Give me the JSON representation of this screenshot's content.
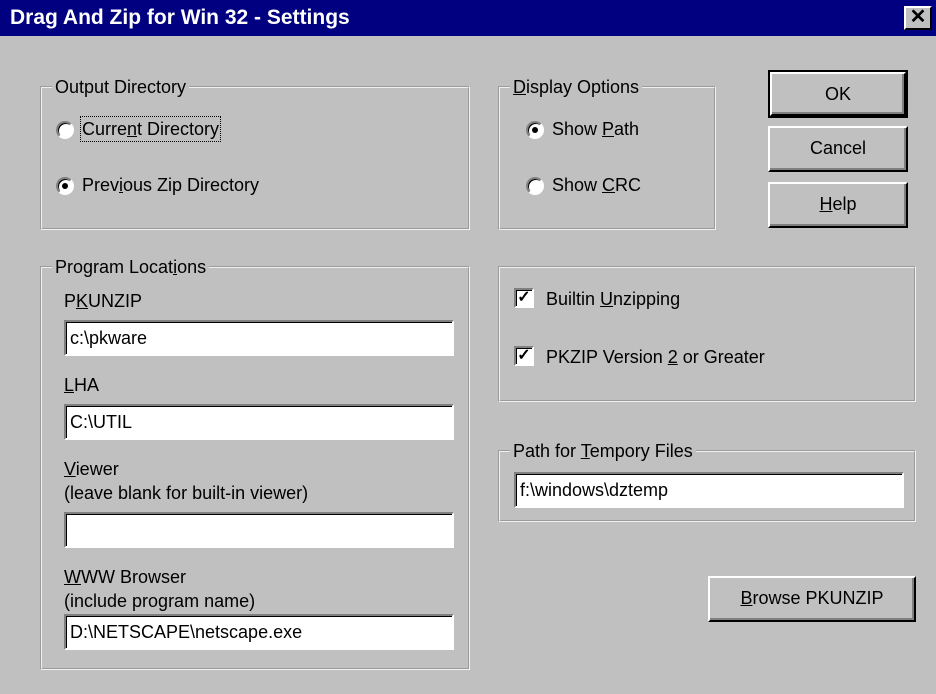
{
  "window": {
    "title": "Drag And Zip for Win 32 - Settings",
    "close_glyph": "✕"
  },
  "output_directory": {
    "legend": "Output Directory",
    "options": [
      {
        "pre": "Curre",
        "key": "n",
        "post": "t Directory",
        "selected": false
      },
      {
        "pre": "Prev",
        "key": "i",
        "post": "ous Zip Directory",
        "selected": true
      }
    ]
  },
  "display_options": {
    "legend_key": "D",
    "legend_rest": "isplay Options",
    "options": [
      {
        "pre": "Show ",
        "key": "P",
        "post": "ath",
        "selected": true
      },
      {
        "pre": "Show ",
        "key": "C",
        "post": "RC",
        "selected": false
      }
    ]
  },
  "buttons": {
    "ok": "OK",
    "cancel": "Cancel",
    "help_key": "H",
    "help_rest": "elp",
    "browse_key": "B",
    "browse_rest": "rowse PKUNZIP"
  },
  "program_locations": {
    "legend_pre": "Program Locat",
    "legend_key": "i",
    "legend_post": "ons",
    "pkunzip": {
      "pre": "P",
      "key": "K",
      "post": "UNZIP",
      "value": "c:\\pkware"
    },
    "lha": {
      "key": "L",
      "post": "HA",
      "value": "C:\\UTIL"
    },
    "viewer": {
      "key": "V",
      "post": "iewer",
      "note": "(leave blank for built-in viewer)",
      "value": ""
    },
    "browser": {
      "key": "W",
      "post": "WW Browser",
      "note": "(include program name)",
      "value": "D:\\NETSCAPE\\netscape.exe"
    }
  },
  "checkboxes": [
    {
      "pre": "Builtin ",
      "key": "U",
      "post": "nzipping",
      "checked": true
    },
    {
      "pre": "PKZIP Version ",
      "key": "2",
      "post": " or Greater",
      "checked": true
    }
  ],
  "temp_path": {
    "legend_pre": "Path for ",
    "legend_key": "T",
    "legend_post": "empory Files",
    "value": "f:\\windows\\dztemp"
  }
}
